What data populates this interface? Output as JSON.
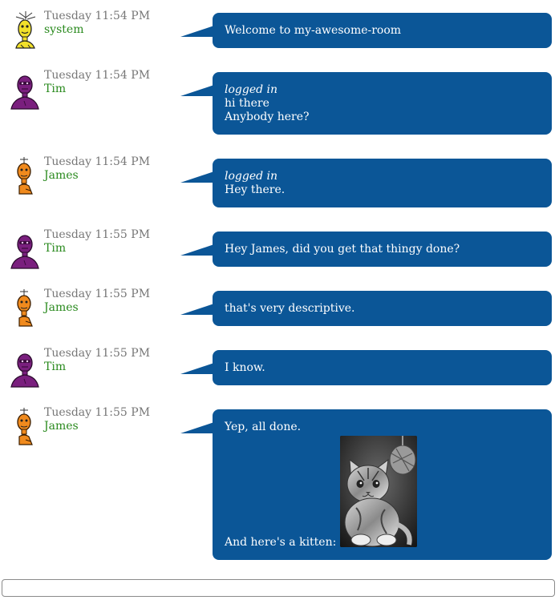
{
  "room": {
    "name": "my-awesome-room"
  },
  "colors": {
    "bubble": "#0b5697",
    "nickname": "#2a8a1e",
    "timestamp": "#777777",
    "avatar_system": "#f1e02a",
    "avatar_tim": "#7a1f7e",
    "avatar_james": "#f08a1d"
  },
  "messages": [
    {
      "timestamp": "Tuesday 11:54 PM",
      "nick": "system",
      "avatar": "yellow-robot-avatar",
      "lines": [
        "Welcome to my-awesome-room"
      ]
    },
    {
      "timestamp": "Tuesday 11:54 PM",
      "nick": "Tim",
      "avatar": "purple-robot-avatar",
      "note": "logged in",
      "lines": [
        "hi there",
        "Anybody here?"
      ]
    },
    {
      "timestamp": "Tuesday 11:54 PM",
      "nick": "James",
      "avatar": "orange-robot-avatar",
      "note": "logged in",
      "lines": [
        "Hey there."
      ]
    },
    {
      "timestamp": "Tuesday 11:55 PM",
      "nick": "Tim",
      "avatar": "purple-robot-avatar",
      "lines": [
        "Hey James, did you get that thingy done?"
      ]
    },
    {
      "timestamp": "Tuesday 11:55 PM",
      "nick": "James",
      "avatar": "orange-robot-avatar",
      "lines": [
        "that's very descriptive."
      ]
    },
    {
      "timestamp": "Tuesday 11:55 PM",
      "nick": "Tim",
      "avatar": "purple-robot-avatar",
      "lines": [
        "I know."
      ]
    },
    {
      "timestamp": "Tuesday 11:55 PM",
      "nick": "James",
      "avatar": "orange-robot-avatar",
      "lines": [
        "Yep, all done."
      ],
      "image_caption": "And here's a kitten:",
      "image": "kitten-photo"
    }
  ],
  "composer": {
    "value": "",
    "placeholder": ""
  }
}
